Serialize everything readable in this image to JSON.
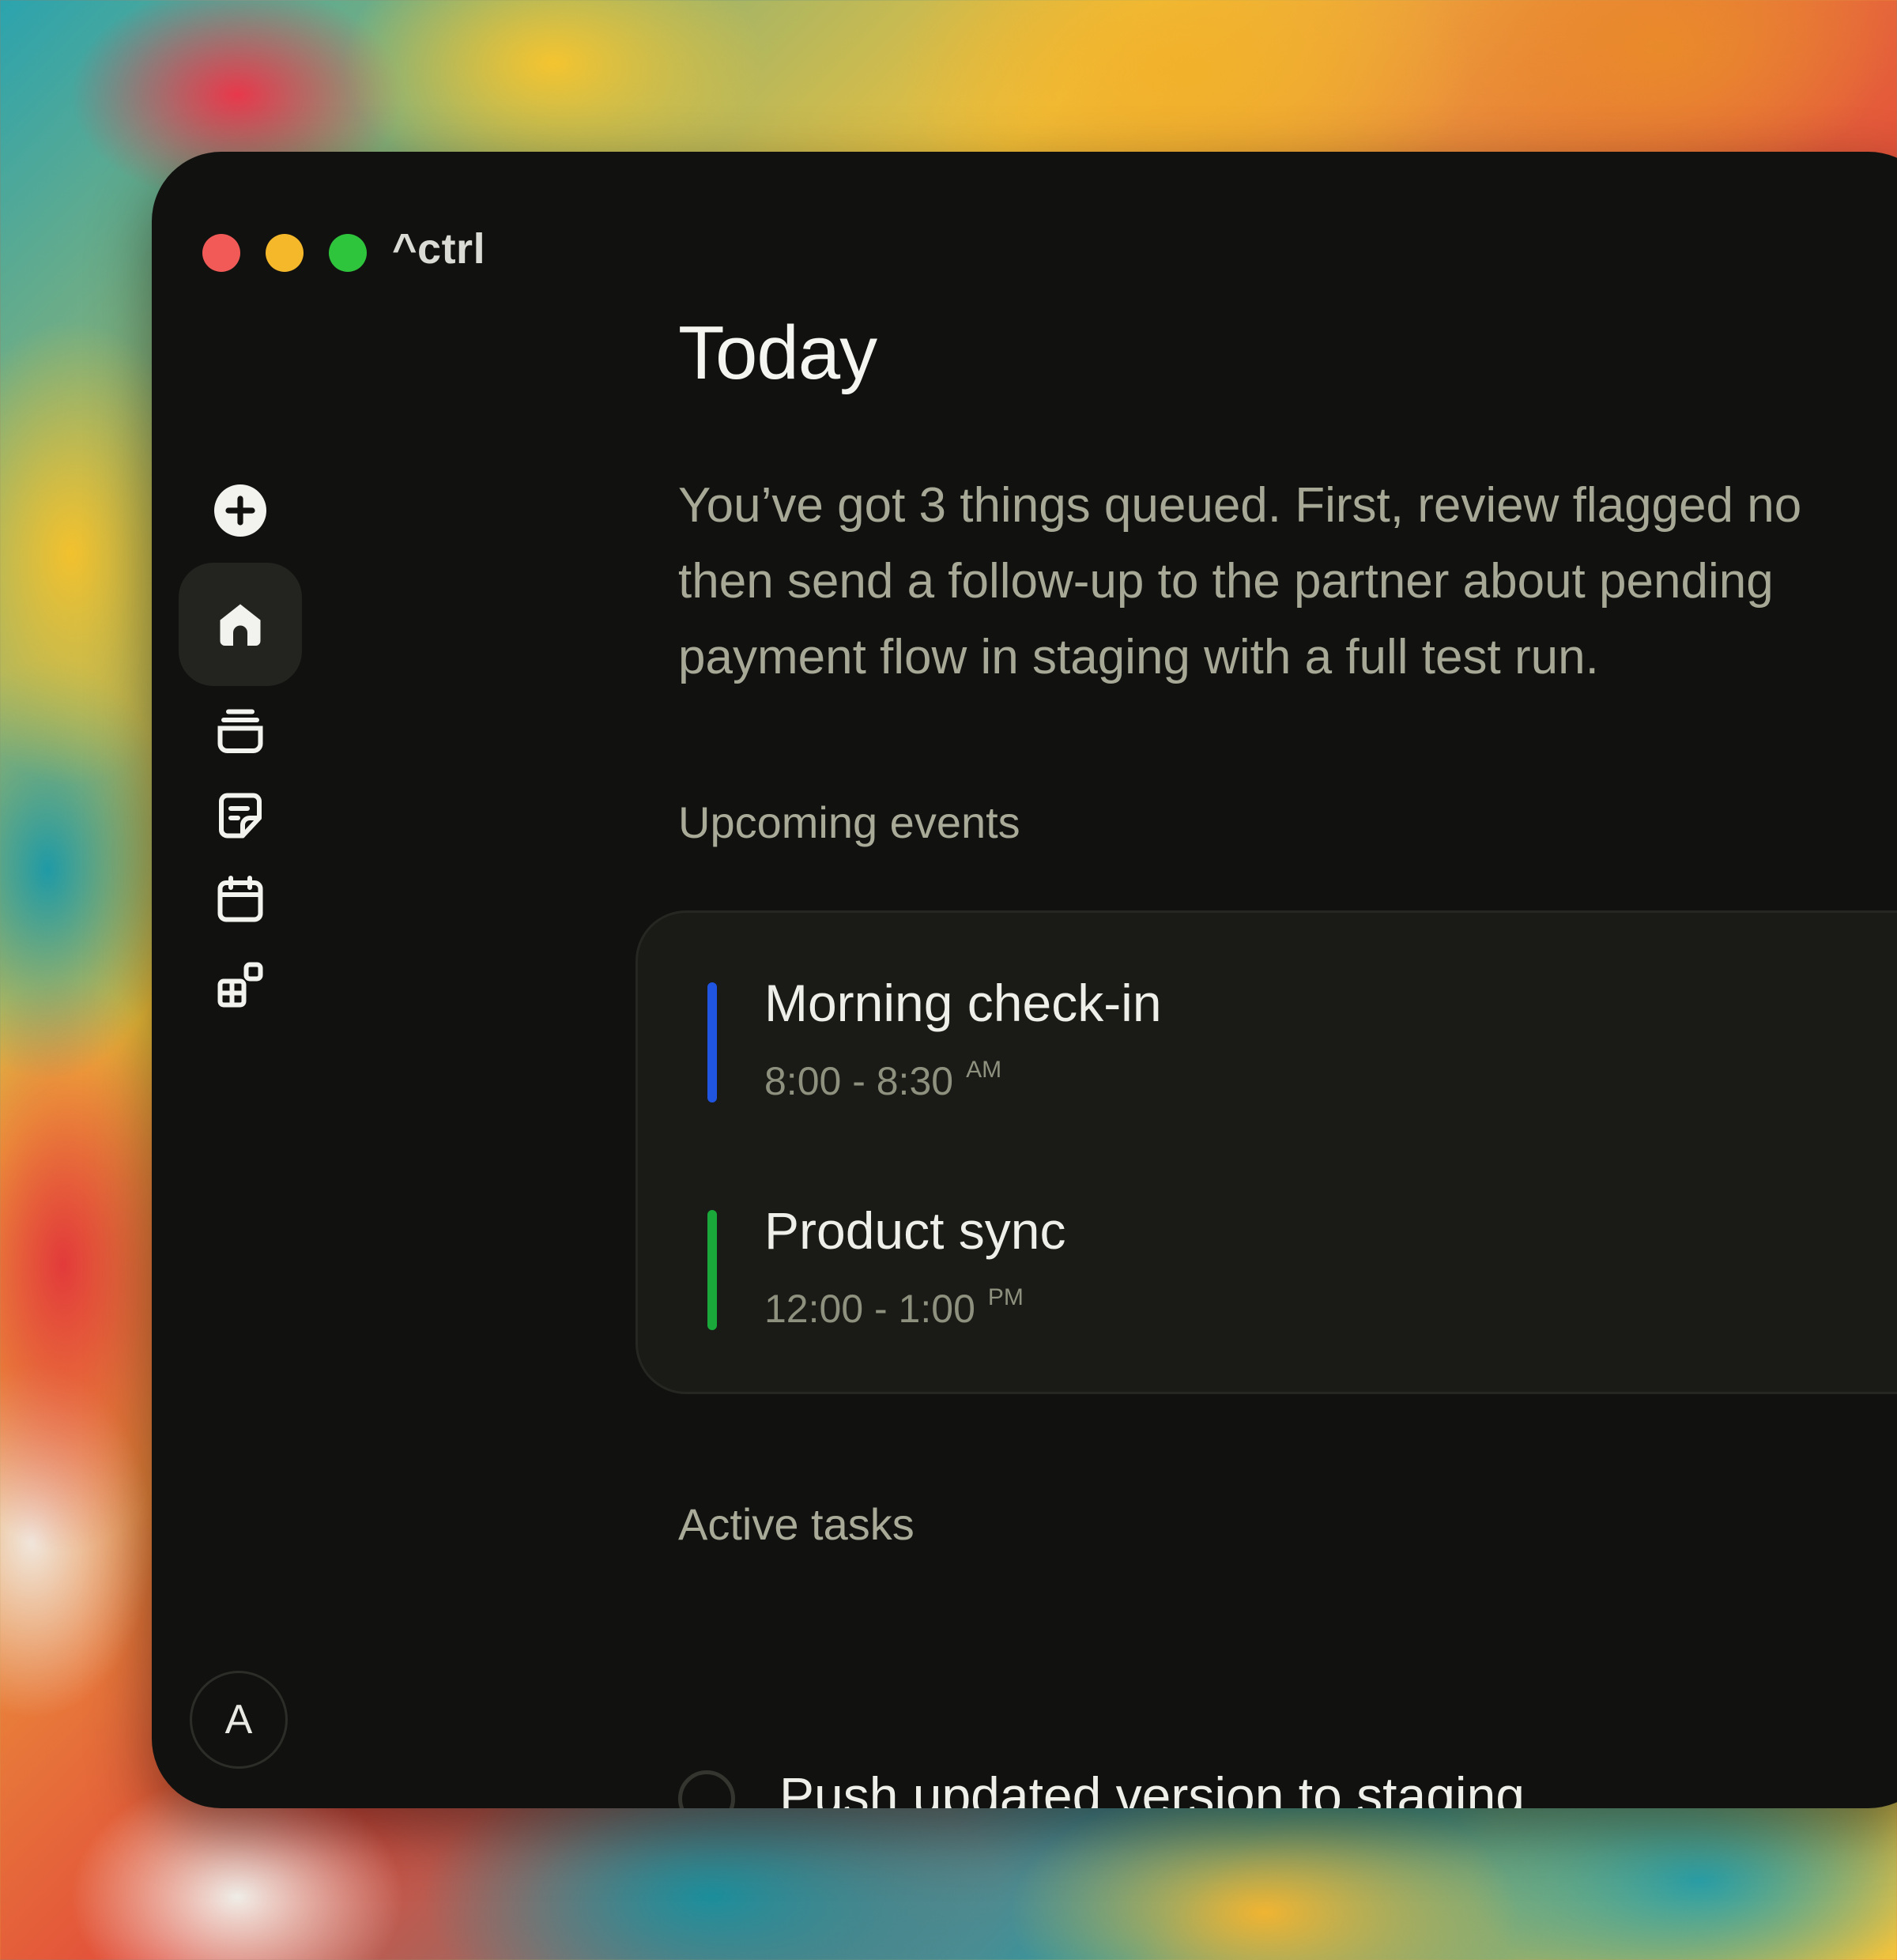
{
  "window": {
    "app_name": "^ctrl",
    "traffic_lights": {
      "close_color": "#f25a57",
      "minimize_color": "#f6b82b",
      "maximize_color": "#2ec53d"
    }
  },
  "sidebar": {
    "items": [
      {
        "icon": "plus-circle-icon",
        "active": false
      },
      {
        "icon": "home-icon",
        "active": true
      },
      {
        "icon": "stack-icon",
        "active": false
      },
      {
        "icon": "note-icon",
        "active": false
      },
      {
        "icon": "calendar-icon",
        "active": false
      },
      {
        "icon": "apps-icon",
        "active": false
      }
    ],
    "avatar_initial": "A"
  },
  "main": {
    "title": "Today",
    "summary": "You’ve got 3 things queued. First, review flagged no\nthen send a follow-up to the partner about pending\npayment flow in staging with a full test run.",
    "upcoming_label": "Upcoming events",
    "events": [
      {
        "title": "Morning check-in",
        "time": "8:00 - 8:30",
        "meridiem": "AM",
        "color": "#1f55e0"
      },
      {
        "title": "Product sync",
        "time": "12:00 - 1:00",
        "meridiem": "PM",
        "color": "#1aa83a"
      }
    ],
    "tasks_label": "Active tasks",
    "tasks": [
      {
        "label": "Push updated version to staging",
        "done": false
      }
    ]
  }
}
